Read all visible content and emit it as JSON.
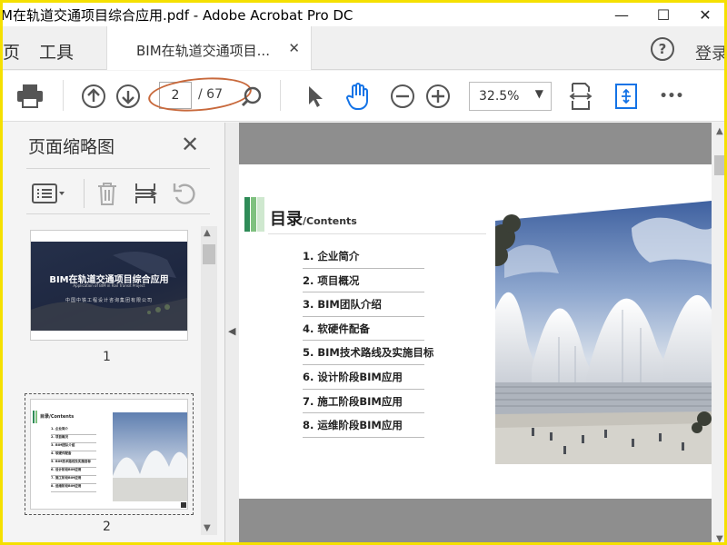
{
  "window": {
    "title": "M在轨道交通项目综合应用.pdf - Adobe Acrobat Pro DC",
    "minimize": "—",
    "maximize": "☐",
    "close": "✕"
  },
  "tabs": {
    "home_partial": "页",
    "tools": "工具",
    "document_tab": "BIM在轨道交通项目...",
    "document_tab_close": "✕",
    "help": "?",
    "login": "登录"
  },
  "toolbar": {
    "current_page": "2",
    "page_total": "/ 67",
    "zoom_value": "32.5%",
    "zoom_caret": "▼",
    "more": "•••",
    "annotation_color": "#c8693c"
  },
  "left_panel": {
    "title": "页面缩略图",
    "close": "✕",
    "thumbnails": [
      {
        "number": "1",
        "title": "BIM在轨道交通项目综合应用",
        "subtitle": "Application of BIM in Rail Transit Project",
        "company": "中国中铁工程设计咨询集团有限公司"
      },
      {
        "number": "2"
      }
    ]
  },
  "document": {
    "heading": "目录",
    "heading_sub": "/Contents",
    "accent_colors": [
      "#2e8b57",
      "#7fc17f",
      "#cfe8cf"
    ],
    "toc": [
      "1. 企业简介",
      "2. 项目概况",
      "3. BIM团队介绍",
      "4. 软硬件配备",
      "5. BIM技术路线及实施目标",
      "6. 设计阶段BIM应用",
      "7. 施工阶段BIM应用",
      "8. 运维阶段BIM应用"
    ],
    "thumbnail_toc": [
      "1. 企业简介",
      "2. 项目概况",
      "3. BIM团队介绍",
      "4. 软硬件配备",
      "5. BIM技术路线及实施目标",
      "6. 设计阶段BIM应用",
      "7. 施工阶段BIM应用",
      "8. 运维阶段BIM应用"
    ]
  }
}
